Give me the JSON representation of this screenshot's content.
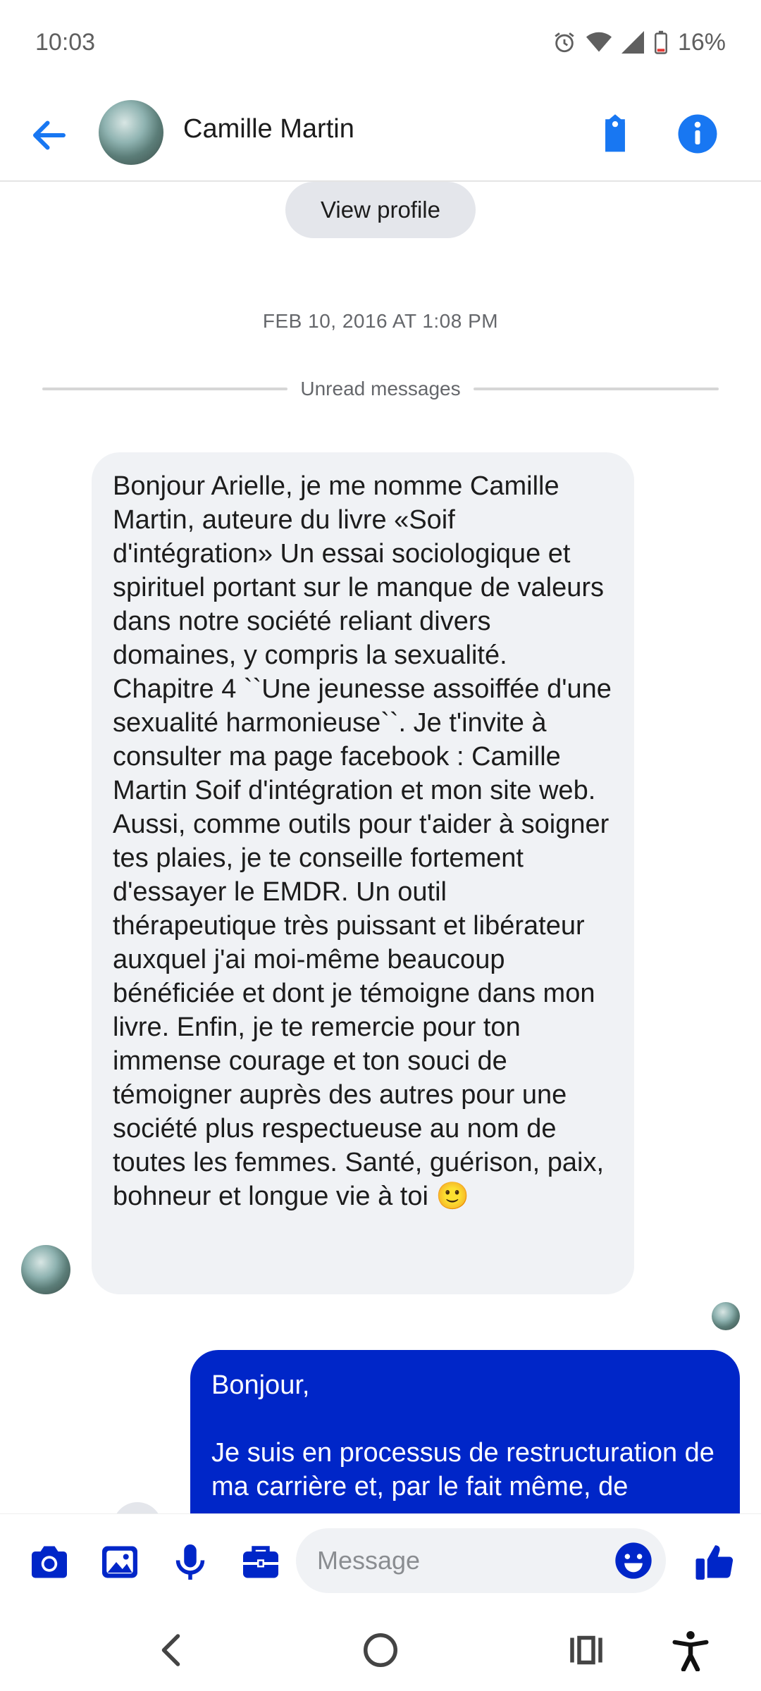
{
  "status_bar": {
    "time": "10:03",
    "battery": "16%",
    "icons": [
      "alarm-icon",
      "wifi-icon",
      "signal-icon",
      "battery-low-icon"
    ]
  },
  "header": {
    "contact_name": "Camille Martin",
    "icons": [
      "back-arrow-icon",
      "tag-icon",
      "info-icon"
    ],
    "accent_color": "#1877f2"
  },
  "conversation": {
    "view_profile_label": "View profile",
    "timestamp": "FEB 10, 2016 AT 1:08 PM",
    "unread_label": "Unread messages",
    "incoming_message": "Bonjour Arielle, je me nomme Camille Martin, auteure du livre «Soif d'intégration» Un essai sociologique et spirituel portant sur le manque de valeurs dans notre société reliant divers domaines, y compris la sexualité. Chapitre 4 ``Une jeunesse assoiffée d'une sexualité harmonieuse``. Je t'invite à consulter ma page facebook : Camille Martin Soif d'intégration et mon site web. Aussi, comme outils pour t'aider à soigner tes plaies, je te conseille fortement d'essayer le EMDR. Un outil thérapeutique très puissant et libérateur auxquel j'ai moi-même beaucoup bénéficiée et dont je témoigne dans mon livre. Enfin, je te remercie pour ton immense courage et ton souci de témoigner auprès des autres pour une société plus respectueuse au nom de toutes les femmes. Santé, guérison, paix, bohneur et longue vie à toi 🙂",
    "outgoing_message": "Bonjour,\n\nJe suis en processus de restructuration de ma carrière et, par le fait même, de",
    "outgoing_bubble_color": "#0026c8"
  },
  "composer": {
    "placeholder": "Message",
    "icons": [
      "camera-icon",
      "gallery-icon",
      "microphone-icon",
      "briefcase-icon",
      "emoji-icon",
      "thumbs-up-icon"
    ],
    "icon_color": "#0026c8"
  },
  "nav_bar": {
    "icons": [
      "back-nav-icon",
      "home-nav-icon",
      "recents-nav-icon",
      "accessibility-icon"
    ]
  }
}
